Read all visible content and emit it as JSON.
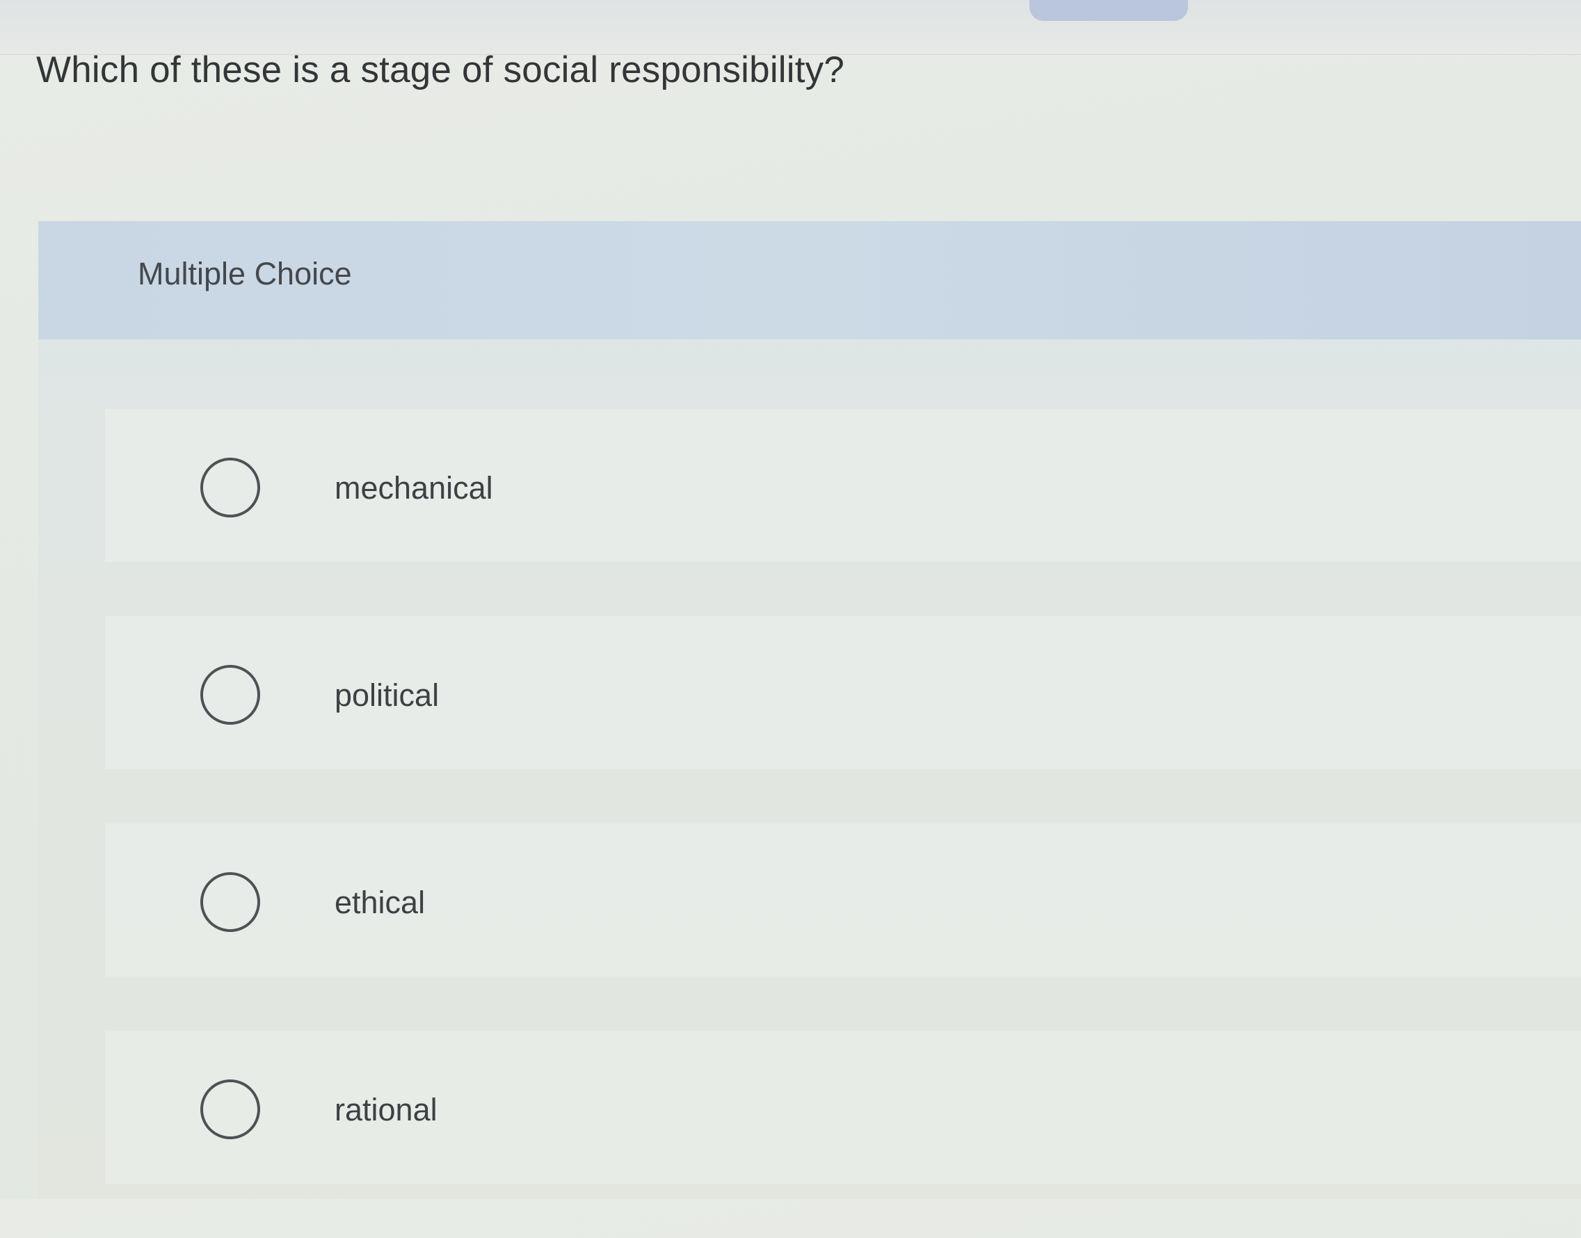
{
  "question": {
    "text": "Which of these is a stage of social responsibility?"
  },
  "panel": {
    "title": "Multiple Choice"
  },
  "choices": [
    {
      "label": "mechanical",
      "selected": false
    },
    {
      "label": "political",
      "selected": false
    },
    {
      "label": "ethical",
      "selected": false
    },
    {
      "label": "rational",
      "selected": false
    }
  ]
}
